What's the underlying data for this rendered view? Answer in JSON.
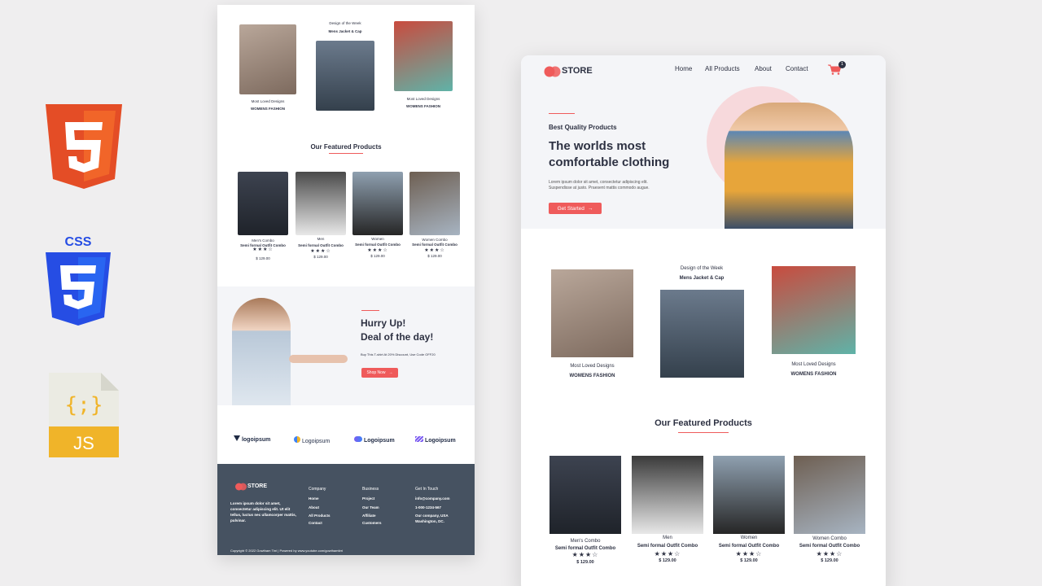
{
  "tech_icons": {
    "html5": "5",
    "js_label": "JS",
    "js_braces": "{;}"
  },
  "store": {
    "brand": "STORE",
    "nav": [
      "Home",
      "All Products",
      "About",
      "Contact"
    ],
    "cart_count": "1",
    "hero": {
      "kicker": "Best Quality Products",
      "title_line1": "The worlds most",
      "title_line2": "comfortable clothing",
      "desc_line1": "Lorem ipsum dolor sit amet, consectetur adipiscing elit.",
      "desc_line2": "Suspendisse at justo. Praesent mattis commodo augue.",
      "cta": "Get Started"
    },
    "designs": {
      "left_caption": "Most  Loved Designs",
      "left_sub": "WOMENS  FASHION",
      "center_caption": "Design of  the Week",
      "center_sub": "Mens Jacket & Cap",
      "right_caption": "Most  Loved Designs",
      "right_sub": "WOMENS  FASHION"
    },
    "featured_title": "Our Featured Products",
    "products": [
      {
        "category": "Men's Combo",
        "name": "Semi formal Outfit Combo",
        "stars": "★★★☆",
        "price": "$ 129.00"
      },
      {
        "category": "Men",
        "name": "Semi formal Outfit Combo",
        "stars": "★★★☆",
        "price": "$ 129.00"
      },
      {
        "category": "Women",
        "name": "Semi formal Outfit Combo",
        "stars": "★★★☆",
        "price": "$ 129.00"
      },
      {
        "category": "Women Combo",
        "name": "Semi formal Outfit Combo",
        "stars": "★★★☆",
        "price": "$ 129.00"
      }
    ],
    "deal": {
      "title_line1": "Hurry Up!",
      "title_line2": "Deal of the day!",
      "desc": "Buy This T-shirt At 20% Discount, Use Code OFF20",
      "cta": "Shop Now"
    },
    "logos": [
      "logoipsum",
      "Logoipsum",
      "Logoipsum",
      "Logoipsum"
    ],
    "footer": {
      "about": "Lorem ipsum dolor sit amet, consectetur adipiscing elit. Ut elit tellus, luctus nec ullamcorper mattis, pulvinar.",
      "columns": [
        {
          "title": "Company",
          "items": [
            "Home",
            "About",
            "All Products",
            "Contact"
          ]
        },
        {
          "title": "Business",
          "items": [
            "Project",
            "Our Team",
            "Affiliate",
            "Customers"
          ]
        },
        {
          "title": "Get In Touch",
          "items": [
            "info@company.com",
            "1-000-1234-567",
            "Our company, USA",
            "Washington, DC."
          ]
        }
      ],
      "copyright": "Copyright © 2022 Gowtham Tirri | Powered by www.youtube.com/gowthamtirri"
    }
  },
  "colors": {
    "accent": "#ef5b5b",
    "footer": "#465261",
    "hero_bg": "#f4f5f8",
    "dark": "#2d3142"
  }
}
